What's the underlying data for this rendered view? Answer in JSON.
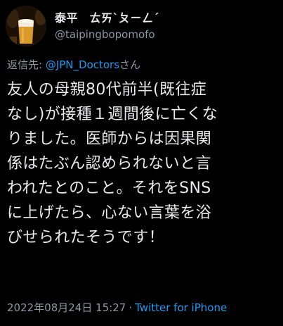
{
  "user": {
    "display_name": "泰平　ㄊㄞˋㄆㄧㄥˊ",
    "handle": "@taipingbopomofo",
    "avatar_icon": "beer-glass-icon"
  },
  "reply": {
    "prefix": "返信先: ",
    "mention": "@JPN_Doctors",
    "suffix": "さん"
  },
  "tweet": {
    "lines": [
      "友人の母親80代前半(既往症",
      "なし)が接種１週間後に亡くな",
      "りました。医師からは因果関",
      "係はたぶん認められないと言",
      "われたとのこと。それをSNS",
      "に上げたら、心ない言葉を浴",
      "びせられたそうです！"
    ]
  },
  "meta": {
    "timestamp": "2022年08月24日 15:27",
    "separator": "·",
    "source": "Twitter for iPhone"
  },
  "colors": {
    "background": "#000000",
    "text": "#e7e9ea",
    "secondary": "#8b98a5",
    "link": "#1d9bf0"
  }
}
